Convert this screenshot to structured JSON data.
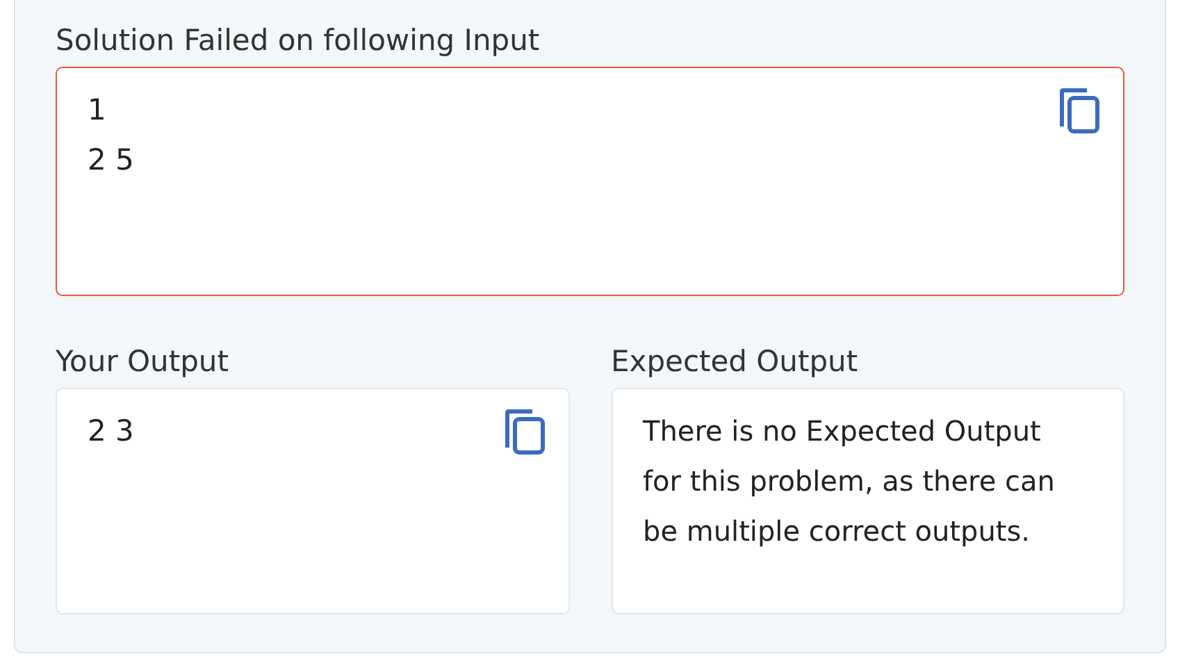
{
  "failed_input": {
    "label": "Solution Failed on following Input",
    "lines": [
      "1",
      "2 5"
    ]
  },
  "your_output": {
    "label": "Your Output",
    "lines": [
      "2 3"
    ]
  },
  "expected_output": {
    "label": "Expected Output",
    "message": "There is no Expected Output for this problem, as there can be multiple correct outputs."
  }
}
